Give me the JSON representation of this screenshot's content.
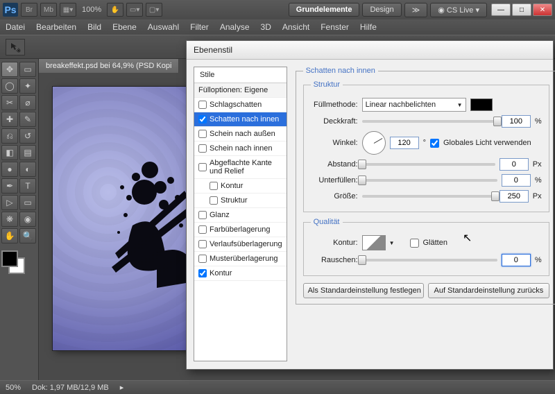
{
  "titlebar": {
    "zoom": "100%",
    "essentials": "Grundelemente",
    "design": "Design",
    "cslive": "CS Live"
  },
  "menu": [
    "Datei",
    "Bearbeiten",
    "Bild",
    "Ebene",
    "Auswahl",
    "Filter",
    "Analyse",
    "3D",
    "Ansicht",
    "Fenster",
    "Hilfe"
  ],
  "doc_tab": "breakeffekt.psd bei 64,9% (PSD Kopi",
  "status": {
    "zoom": "50%",
    "dok": "Dok: 1,97 MB/12,9 MB"
  },
  "dialog": {
    "title": "Ebenenstil",
    "styles_header": "Stile",
    "fill_options": "Fülloptionen: Eigene",
    "styles": [
      {
        "label": "Schlagschatten",
        "checked": false,
        "selected": false
      },
      {
        "label": "Schatten nach innen",
        "checked": true,
        "selected": true
      },
      {
        "label": "Schein nach außen",
        "checked": false,
        "selected": false
      },
      {
        "label": "Schein nach innen",
        "checked": false,
        "selected": false
      },
      {
        "label": "Abgeflachte Kante und Relief",
        "checked": false,
        "selected": false
      },
      {
        "label": "Kontur",
        "checked": false,
        "selected": false,
        "indent": true
      },
      {
        "label": "Struktur",
        "checked": false,
        "selected": false,
        "indent": true
      },
      {
        "label": "Glanz",
        "checked": false,
        "selected": false
      },
      {
        "label": "Farbüberlagerung",
        "checked": false,
        "selected": false
      },
      {
        "label": "Verlaufsüberlagerung",
        "checked": false,
        "selected": false
      },
      {
        "label": "Musterüberlagerung",
        "checked": false,
        "selected": false
      },
      {
        "label": "Kontur",
        "checked": true,
        "selected": false
      }
    ],
    "panel_title": "Schatten nach innen",
    "struct_legend": "Struktur",
    "fuellmethode_label": "Füllmethode:",
    "fuellmethode_value": "Linear nachbelichten",
    "deckkraft_label": "Deckkraft:",
    "deckkraft_value": "100",
    "percent": "%",
    "winkel_label": "Winkel:",
    "winkel_value": "120",
    "degree": "°",
    "global_light": "Globales Licht verwenden",
    "abstand_label": "Abstand:",
    "abstand_value": "0",
    "px": "Px",
    "unterfuellen_label": "Unterfüllen:",
    "unterfuellen_value": "0",
    "groesse_label": "Größe:",
    "groesse_value": "250",
    "qualitaet_legend": "Qualität",
    "kontur_label": "Kontur:",
    "glaetten": "Glätten",
    "rauschen_label": "Rauschen:",
    "rauschen_value": "0",
    "btn_default": "Als Standardeinstellung festlegen",
    "btn_reset": "Auf Standardeinstellung zurücks"
  }
}
